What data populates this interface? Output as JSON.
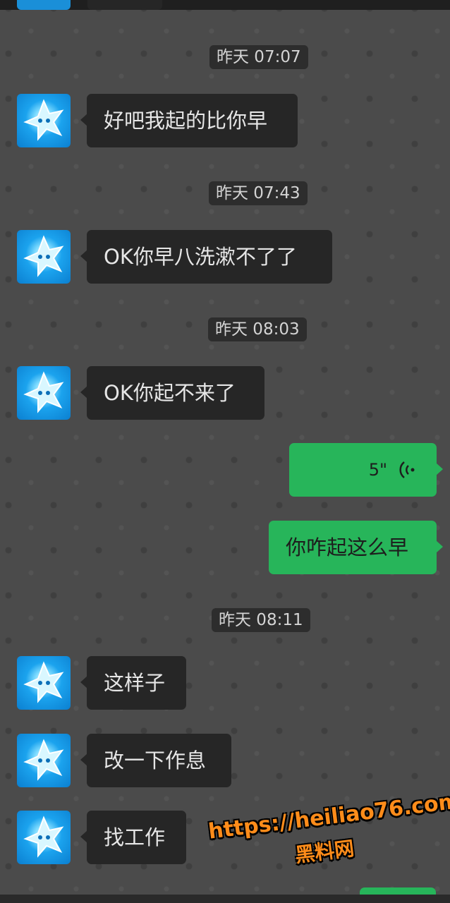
{
  "messages": [
    {
      "type": "timestamp",
      "text": "昨天 07:07"
    },
    {
      "type": "incoming",
      "text": "好吧我起的比你早"
    },
    {
      "type": "timestamp",
      "text": "昨天 07:43"
    },
    {
      "type": "incoming",
      "text": "OK你早八洗漱不了了"
    },
    {
      "type": "timestamp",
      "text": "昨天 08:03"
    },
    {
      "type": "incoming",
      "text": "OK你起不来了"
    },
    {
      "type": "outgoing-voice",
      "text": "5\"",
      "icon": "voice-wave-icon"
    },
    {
      "type": "outgoing",
      "text": "你咋起这么早"
    },
    {
      "type": "timestamp",
      "text": "昨天 08:11"
    },
    {
      "type": "incoming",
      "text": "这样子"
    },
    {
      "type": "incoming",
      "text": "改一下作息"
    },
    {
      "type": "incoming",
      "text": "找工作"
    }
  ],
  "watermark": {
    "url": "https://heiliao76.com",
    "name": "黑料网",
    "color": "#ff8c1a"
  },
  "colors": {
    "background": "#4b4b4b",
    "incoming_bubble": "#262626",
    "outgoing_bubble": "#27b55a",
    "avatar": "#1ba3ee"
  }
}
